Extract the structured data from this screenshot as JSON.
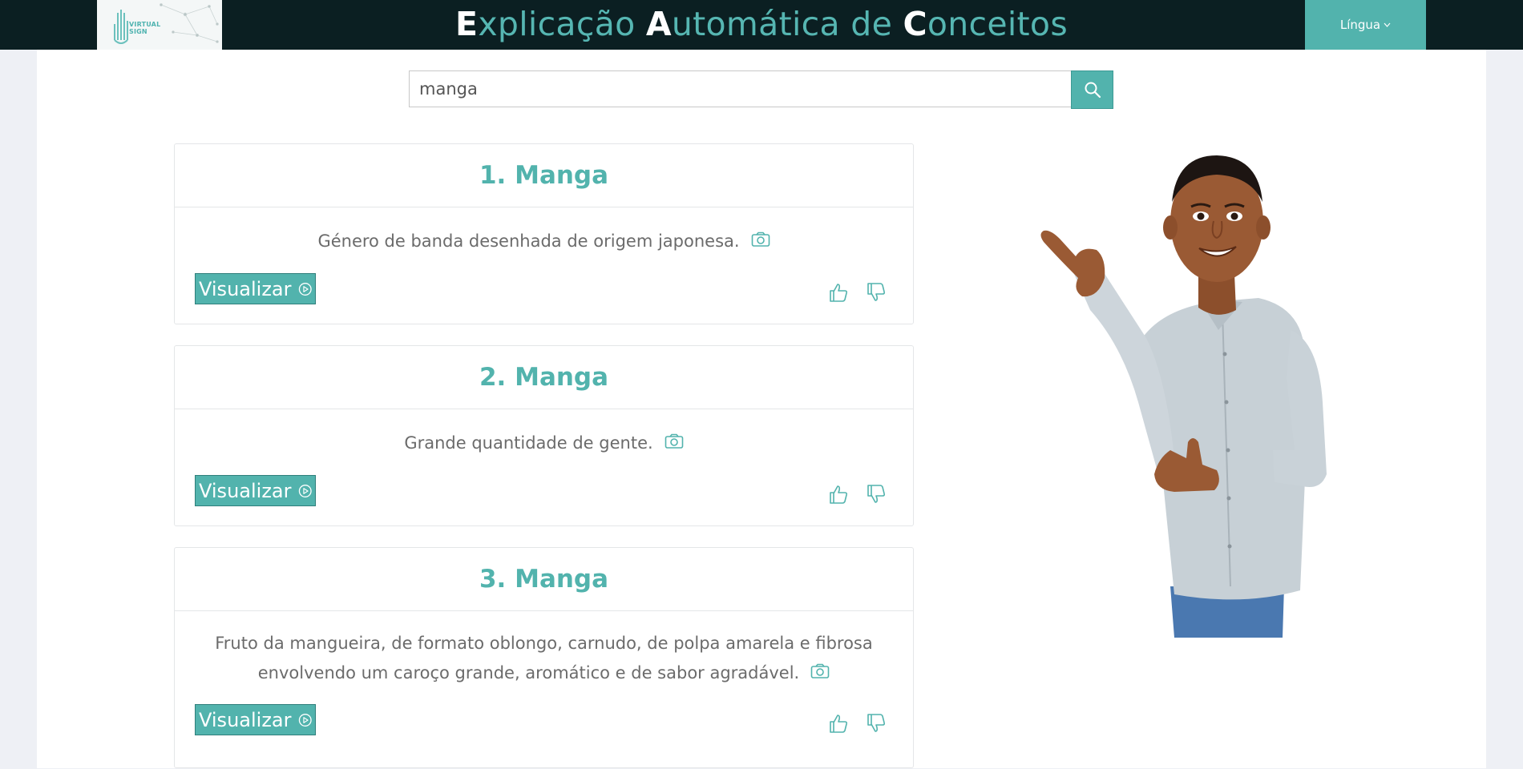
{
  "header": {
    "logo_text_line1": "VIRTUAL",
    "logo_text_line2": "SIGN",
    "title_parts": [
      "E",
      "xplicação ",
      "A",
      "utomática de ",
      "C",
      "onceitos"
    ],
    "language_label": "Língua"
  },
  "search": {
    "value": "manga",
    "icon": "search-icon"
  },
  "results": [
    {
      "title": "1. Manga",
      "definition": "Género de banda desenhada de origem japonesa.",
      "button_label": "Visualizar"
    },
    {
      "title": "2. Manga",
      "definition": "Grande quantidade de gente.",
      "button_label": "Visualizar"
    },
    {
      "title": "3. Manga",
      "definition_line1": "Fruto da mangueira, de formato oblongo, carnudo, de polpa amarela e fibrosa",
      "definition_line2": "envolvendo um caroço grande, aromático e de sabor agradável.",
      "button_label": "Visualizar"
    }
  ],
  "icons": {
    "camera": "camera-icon",
    "play": "play-circle-icon",
    "like": "thumbs-up-icon",
    "dislike": "thumbs-down-icon"
  },
  "colors": {
    "accent": "#52b3ad",
    "header_bg": "#0b1f22",
    "page_bg": "#eef0f5"
  }
}
